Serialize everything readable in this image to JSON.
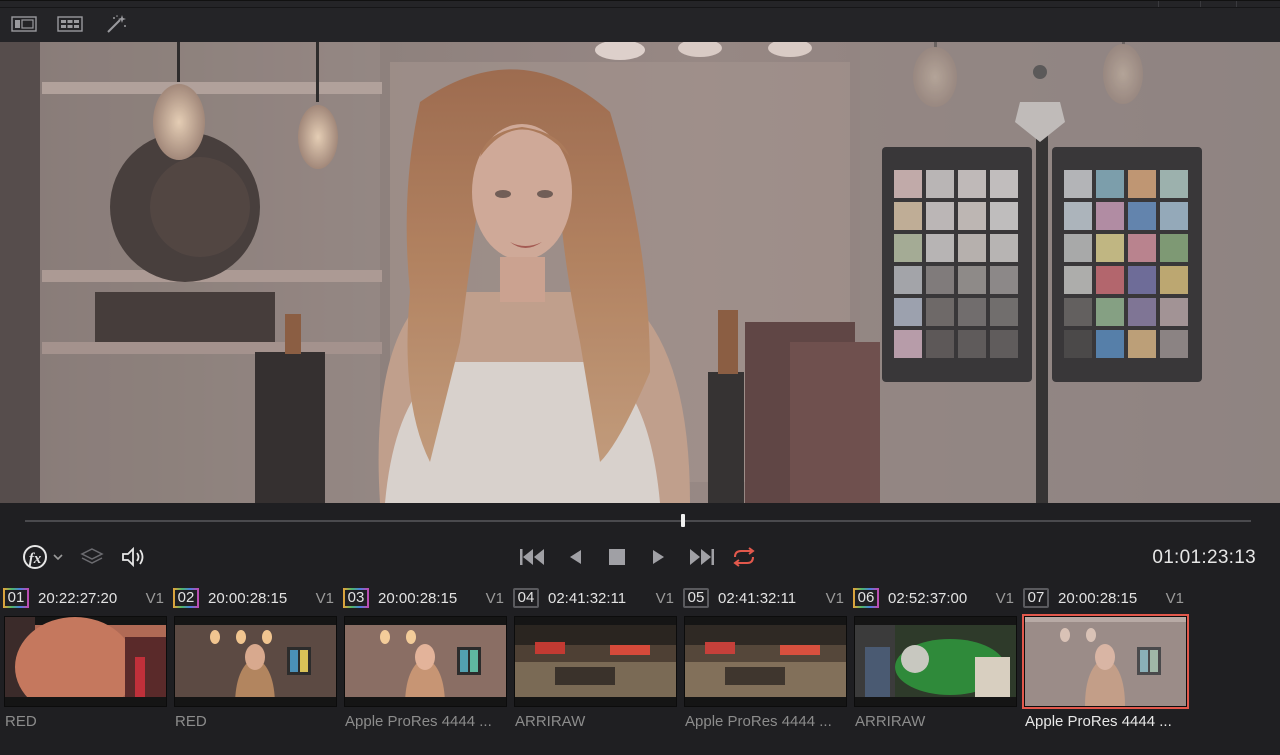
{
  "toolbar": {
    "icons": [
      "single-viewer-icon",
      "gallery-grid-icon",
      "magic-wand-icon"
    ]
  },
  "transport": {
    "timecode": "01:01:23:13",
    "playhead_fraction": 0.537,
    "loop_color": "#e2584c"
  },
  "clips": [
    {
      "number": "01",
      "timecode": "20:22:27:20",
      "track": "V1",
      "codec": "RED",
      "badge_color": "gradient"
    },
    {
      "number": "02",
      "timecode": "20:00:28:15",
      "track": "V1",
      "codec": "RED",
      "badge_color": "gradient"
    },
    {
      "number": "03",
      "timecode": "20:00:28:15",
      "track": "V1",
      "codec": "Apple ProRes 4444 ...",
      "badge_color": "gradient"
    },
    {
      "number": "04",
      "timecode": "02:41:32:11",
      "track": "V1",
      "codec": "ARRIRAW",
      "badge_color": "#5a5a5e"
    },
    {
      "number": "05",
      "timecode": "02:41:32:11",
      "track": "V1",
      "codec": "Apple ProRes 4444 ...",
      "badge_color": "#5a5a5e"
    },
    {
      "number": "06",
      "timecode": "02:52:37:00",
      "track": "V1",
      "codec": "ARRIRAW",
      "badge_color": "gradient"
    },
    {
      "number": "07",
      "timecode": "20:00:28:15",
      "track": "V1",
      "codec": "Apple ProRes 4444 ...",
      "badge_color": "#5a5a5e",
      "selected": true
    }
  ],
  "colors": {
    "accent_red": "#e2584c",
    "background": "#1f1f22"
  }
}
